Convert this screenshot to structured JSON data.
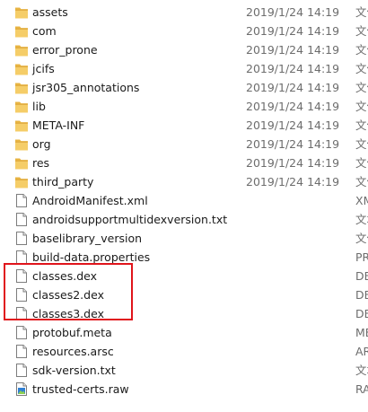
{
  "files": [
    {
      "name": "assets",
      "date": "2019/1/24 14:19",
      "type": "文件夹",
      "icon": "folder-icon"
    },
    {
      "name": "com",
      "date": "2019/1/24 14:19",
      "type": "文件夹",
      "icon": "folder-icon"
    },
    {
      "name": "error_prone",
      "date": "2019/1/24 14:19",
      "type": "文件夹",
      "icon": "folder-icon"
    },
    {
      "name": "jcifs",
      "date": "2019/1/24 14:19",
      "type": "文件夹",
      "icon": "folder-icon"
    },
    {
      "name": "jsr305_annotations",
      "date": "2019/1/24 14:19",
      "type": "文件夹",
      "icon": "folder-icon"
    },
    {
      "name": "lib",
      "date": "2019/1/24 14:19",
      "type": "文件夹",
      "icon": "folder-icon"
    },
    {
      "name": "META-INF",
      "date": "2019/1/24 14:19",
      "type": "文件夹",
      "icon": "folder-icon"
    },
    {
      "name": "org",
      "date": "2019/1/24 14:19",
      "type": "文件夹",
      "icon": "folder-icon"
    },
    {
      "name": "res",
      "date": "2019/1/24 14:19",
      "type": "文件夹",
      "icon": "folder-icon"
    },
    {
      "name": "third_party",
      "date": "2019/1/24 14:19",
      "type": "文件夹",
      "icon": "folder-icon"
    },
    {
      "name": "AndroidManifest.xml",
      "date": "",
      "type": "XML",
      "icon": "document-icon"
    },
    {
      "name": "androidsupportmultidexversion.txt",
      "date": "",
      "type": "文本",
      "icon": "document-icon"
    },
    {
      "name": "baselibrary_version",
      "date": "",
      "type": "文件",
      "icon": "document-icon"
    },
    {
      "name": "build-data.properties",
      "date": "",
      "type": "PRO",
      "icon": "document-icon"
    },
    {
      "name": "classes.dex",
      "date": "",
      "type": "DEX",
      "icon": "document-icon"
    },
    {
      "name": "classes2.dex",
      "date": "",
      "type": "DEX",
      "icon": "document-icon"
    },
    {
      "name": "classes3.dex",
      "date": "",
      "type": "DEX",
      "icon": "document-icon"
    },
    {
      "name": "protobuf.meta",
      "date": "",
      "type": "MET",
      "icon": "document-icon"
    },
    {
      "name": "resources.arsc",
      "date": "",
      "type": "ARS",
      "icon": "document-icon"
    },
    {
      "name": "sdk-version.txt",
      "date": "",
      "type": "文本",
      "icon": "document-icon"
    },
    {
      "name": "trusted-certs.raw",
      "date": "",
      "type": "RAW",
      "icon": "image-file-icon"
    }
  ],
  "colors": {
    "folder": "#e8b443",
    "folder_light": "#f7d57c",
    "highlight": "#e0141b"
  }
}
